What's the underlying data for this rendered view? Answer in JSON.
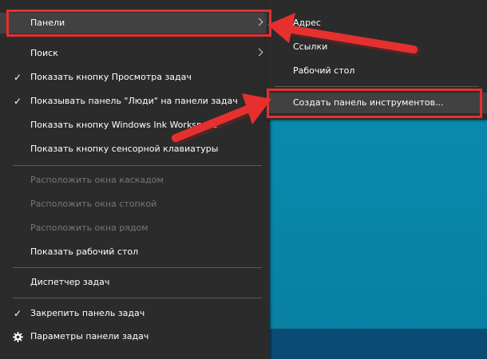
{
  "context_menu": {
    "panels": "Панели",
    "search": "Поиск",
    "show_task_view": "Показать кнопку Просмотра задач",
    "show_people": "Показывать панель \"Люди\" на панели задач",
    "show_ink": "Показать кнопку Windows Ink Workspace",
    "show_keyboard": "Показать кнопку сенсорной клавиатуры",
    "cascade": "Расположить окна каскадом",
    "stack": "Расположить окна стопкой",
    "side_by_side": "Расположить окна рядом",
    "show_desktop": "Показать рабочий стол",
    "task_manager": "Диспетчер задач",
    "lock_taskbar": "Закрепить панель задач",
    "taskbar_settings": "Параметры панели задач",
    "check_glyph": "✓"
  },
  "submenu": {
    "address": "Адрес",
    "links": "Ссылки",
    "desktop": "Рабочий стол",
    "new_toolbar": "Создать панель инструментов..."
  },
  "colors": {
    "menu_bg": "#2b2b2b",
    "highlight": "#414141",
    "annotation_red": "#e5302f",
    "desktop": "#0b8fb3",
    "taskbar": "#0a4b74"
  },
  "icons": [
    "check-icon",
    "chevron-right-icon",
    "gear-icon",
    "annotation-arrow"
  ]
}
